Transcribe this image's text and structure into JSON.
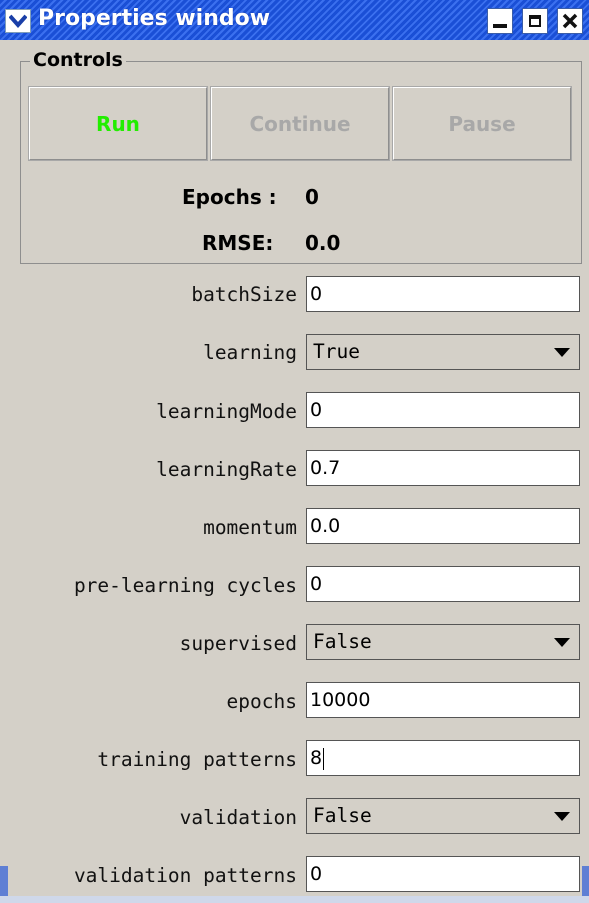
{
  "window": {
    "title": "Properties window",
    "title_bg": "#2b5ce6",
    "controls": [
      "menu-arrow",
      "minimize",
      "maximize",
      "close"
    ]
  },
  "controls_group": {
    "legend": "Controls",
    "buttons": [
      {
        "label": "Run",
        "color": "#22ee00",
        "enabled": true
      },
      {
        "label": "Continue",
        "color": "#a8a8a8",
        "enabled": false
      },
      {
        "label": "Pause",
        "color": "#a8a8a8",
        "enabled": false
      }
    ],
    "epochs_label": "Epochs :",
    "epochs_value": "0",
    "rmse_label": "RMSE:",
    "rmse_value": "0.0"
  },
  "properties": [
    {
      "label": "batchSize",
      "type": "text",
      "value": "0"
    },
    {
      "label": "learning",
      "type": "select",
      "value": "True"
    },
    {
      "label": "learningMode",
      "type": "text",
      "value": "0"
    },
    {
      "label": "learningRate",
      "type": "text",
      "value": "0.7"
    },
    {
      "label": "momentum",
      "type": "text",
      "value": "0.0"
    },
    {
      "label": "pre-learning cycles",
      "type": "text",
      "value": "0"
    },
    {
      "label": "supervised",
      "type": "select",
      "value": "False"
    },
    {
      "label": "epochs",
      "type": "text",
      "value": "10000"
    },
    {
      "label": "training patterns",
      "type": "text",
      "value": "8",
      "focused": true
    },
    {
      "label": "validation",
      "type": "select",
      "value": "False"
    },
    {
      "label": "validation patterns",
      "type": "text",
      "value": "0"
    }
  ]
}
